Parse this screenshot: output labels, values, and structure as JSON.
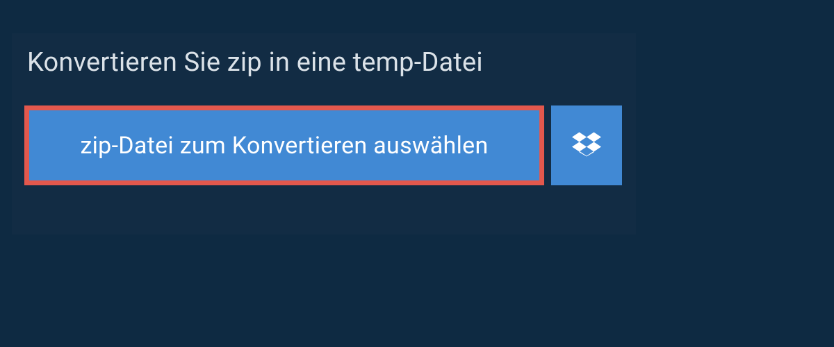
{
  "heading": "Konvertieren Sie zip in eine temp-Datei",
  "buttons": {
    "choose_file_label": "zip-Datei zum Konvertieren auswählen"
  },
  "colors": {
    "background": "#0e2a42",
    "panel": "#122c44",
    "button_bg": "#4189d4",
    "highlight_border": "#e3584d",
    "text_light": "#dbe2e8"
  }
}
